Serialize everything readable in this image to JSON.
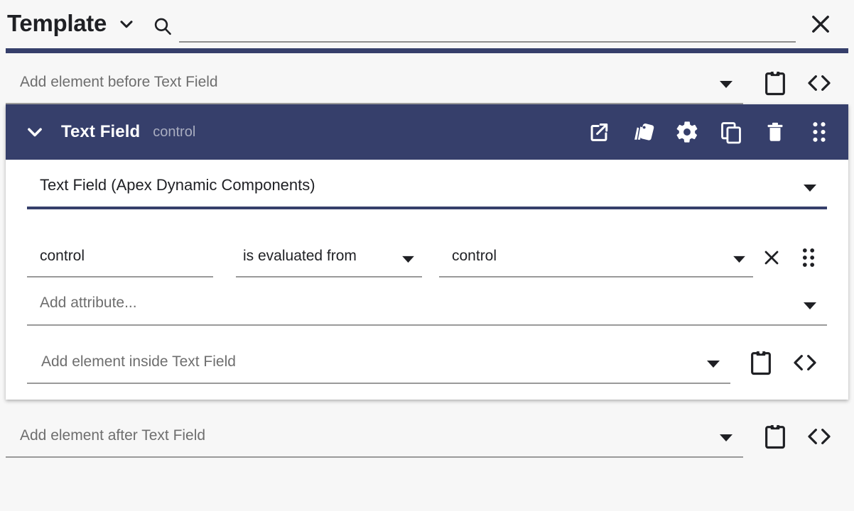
{
  "topbar": {
    "title": "Template",
    "title_caret_icon": "chevron-down-icon",
    "search_icon": "search-icon",
    "search_value": "",
    "search_placeholder": "",
    "close_icon": "close-icon",
    "accent_color": "#363f6b"
  },
  "add_before": {
    "placeholder": "Add element before Text Field",
    "dropdown_icon": "caret-down-icon",
    "paste_icon": "clipboard-icon",
    "code_icon": "code-brackets-icon"
  },
  "element": {
    "header": {
      "collapse_icon": "chevron-down-icon",
      "title": "Text Field",
      "subtitle": "control",
      "actions": [
        {
          "name": "open-in-new-icon",
          "label": "Open in new"
        },
        {
          "name": "style-cards-icon",
          "label": "Style"
        },
        {
          "name": "gear-icon",
          "label": "Settings"
        },
        {
          "name": "copy-icon",
          "label": "Copy"
        },
        {
          "name": "trash-icon",
          "label": "Delete"
        },
        {
          "name": "drag-handle-icon",
          "label": "Drag"
        }
      ]
    },
    "type_select": {
      "value": "Text Field (Apex Dynamic Components)",
      "dropdown_icon": "caret-down-icon"
    },
    "attributes": [
      {
        "name": "control",
        "operator": "is evaluated from",
        "operator_icon": "caret-down-icon",
        "value": "control",
        "value_icon": "caret-down-icon",
        "remove_icon": "close-icon",
        "drag_icon": "drag-handle-icon"
      }
    ],
    "add_attribute": {
      "placeholder": "Add attribute...",
      "dropdown_icon": "caret-down-icon"
    },
    "add_inside": {
      "placeholder": "Add element inside Text Field",
      "dropdown_icon": "caret-down-icon",
      "paste_icon": "clipboard-icon",
      "code_icon": "code-brackets-icon"
    }
  },
  "add_after": {
    "placeholder": "Add element after Text Field",
    "dropdown_icon": "caret-down-icon",
    "paste_icon": "clipboard-icon",
    "code_icon": "code-brackets-icon"
  }
}
